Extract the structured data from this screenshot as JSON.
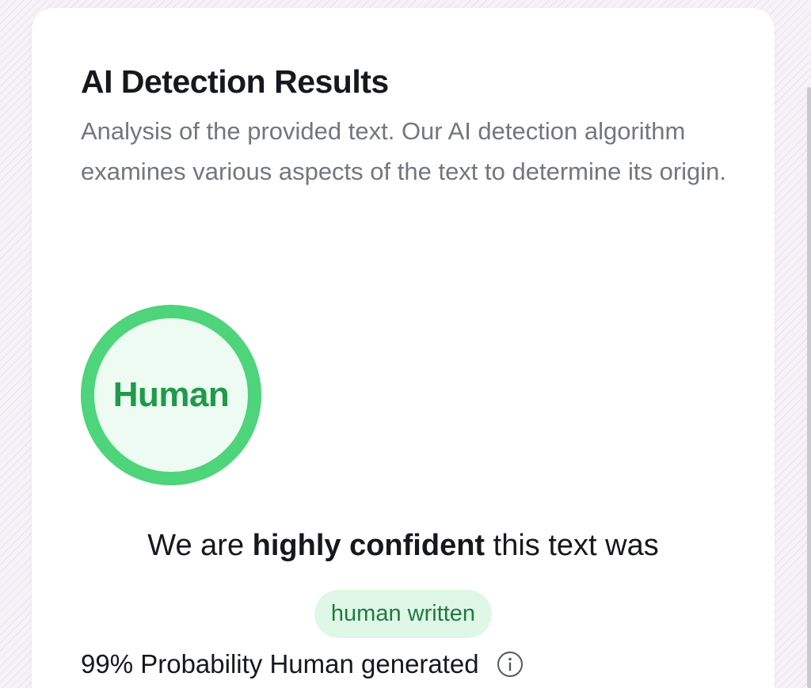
{
  "title": "AI Detection Results",
  "description": "Analysis of the provided text. Our AI detection algorithm examines various aspects of the text to determine its origin.",
  "verdict": {
    "ring_label": "Human",
    "confidence_prefix": "We are ",
    "confidence_emphasis": "highly confident",
    "confidence_suffix": " this text was",
    "badge": "human written",
    "probability_text": "99% Probability Human generated"
  },
  "icons": {
    "info": "info-circle-icon"
  },
  "colors": {
    "ring": "#4ed47a",
    "ring_text": "#1f9a4a",
    "badge_bg": "#dff7e7",
    "badge_text": "#1f7a3e"
  }
}
